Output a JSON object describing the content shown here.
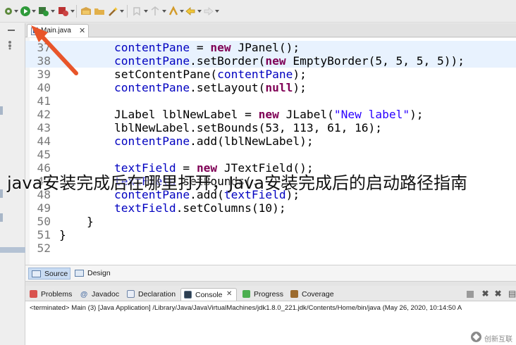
{
  "editor": {
    "tab_label": "Main.java",
    "tab_close": "✕",
    "lines": [
      {
        "n": "37",
        "code": "        contentPane = new JPanel();"
      },
      {
        "n": "38",
        "code": "        contentPane.setBorder(new EmptyBorder(5, 5, 5, 5));"
      },
      {
        "n": "39",
        "code": "        setContentPane(contentPane);"
      },
      {
        "n": "40",
        "code": "        contentPane.setLayout(null);"
      },
      {
        "n": "41",
        "code": ""
      },
      {
        "n": "42",
        "code": "        JLabel lblNewLabel = new JLabel(\"New label\");"
      },
      {
        "n": "43",
        "code": "        lblNewLabel.setBounds(53, 113, 61, 16);"
      },
      {
        "n": "44",
        "code": "        contentPane.add(lblNewLabel);"
      },
      {
        "n": "45",
        "code": ""
      },
      {
        "n": "46",
        "code": "        textField = new JTextField();"
      },
      {
        "n": "47",
        "code": "        textField.setBounds(...);"
      },
      {
        "n": "48",
        "code": "        contentPane.add(textField);"
      },
      {
        "n": "49",
        "code": "        textField.setColumns(10);"
      },
      {
        "n": "50",
        "code": "    }"
      },
      {
        "n": "51",
        "code": "}"
      },
      {
        "n": "52",
        "code": ""
      }
    ]
  },
  "watermark_title": "java安装完成后在哪里打开，Java安装完成后的启动路径指南",
  "editor_mode_tabs": {
    "source": "Source",
    "design": "Design"
  },
  "views": {
    "problems": "Problems",
    "javadoc": "Javadoc",
    "declaration": "Declaration",
    "console": "Console",
    "console_close": "✕",
    "progress": "Progress",
    "coverage": "Coverage"
  },
  "console": {
    "status": "<terminated> Main (3) [Java Application] /Library/Java/JavaVirtualMachines/jdk1.8.0_221.jdk/Contents/Home/bin/java  (May 26, 2020, 10:14:50 A"
  },
  "logo_text": "创新互联",
  "colors": {
    "keyword": "#7f0055",
    "field": "#0000c0",
    "string": "#2a00ff",
    "arrow": "#e8552a",
    "current_line": "#e8f2fe"
  }
}
